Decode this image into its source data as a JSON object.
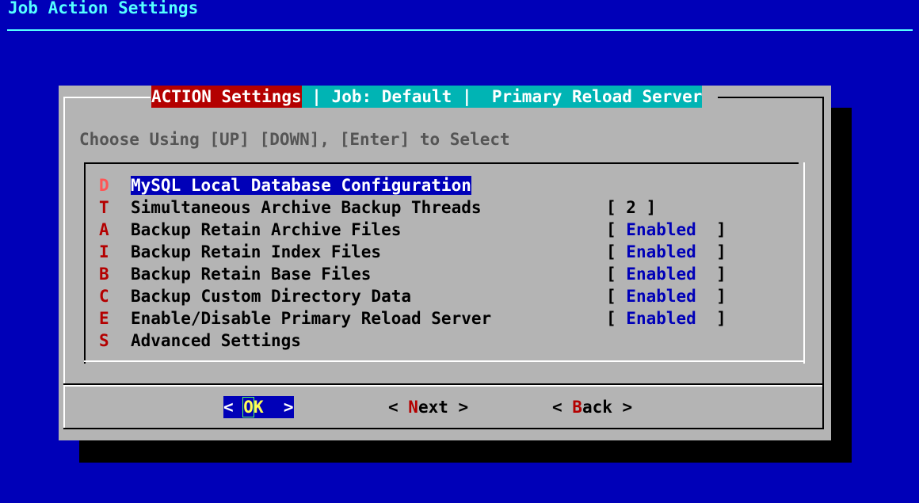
{
  "backtitle": "Job Action Settings",
  "dialog": {
    "title_action": "ACTION Settings",
    "title_rest": " | Job: Default |  Primary Reload Server",
    "prompt": "Choose Using [UP] [DOWN], [Enter] to Select"
  },
  "menu": {
    "items": [
      {
        "tag": "D",
        "label": "MySQL Local Database Configuration",
        "value": ""
      },
      {
        "tag": "T",
        "label": "Simultaneous Archive Backup Threads",
        "value": "2"
      },
      {
        "tag": "A",
        "label": "Backup Retain Archive Files",
        "value": "Enabled"
      },
      {
        "tag": "I",
        "label": "Backup Retain Index Files",
        "value": "Enabled"
      },
      {
        "tag": "B",
        "label": "Backup Retain Base Files",
        "value": "Enabled"
      },
      {
        "tag": "C",
        "label": "Backup Custom Directory Data",
        "value": "Enabled"
      },
      {
        "tag": "E",
        "label": "Enable/Disable Primary Reload Server",
        "value": "Enabled"
      },
      {
        "tag": "S",
        "label": "Advanced Settings",
        "value": ""
      }
    ]
  },
  "buttons": {
    "ok": {
      "left": "< ",
      "hot": "O",
      "rest": "K",
      "right": "  >"
    },
    "next": {
      "left": "< ",
      "hot": "N",
      "rest": "ext",
      "right": " >"
    },
    "back": {
      "left": "< ",
      "hot": "B",
      "rest": "ack",
      "right": " >"
    }
  },
  "colors": {
    "background": "#0000b8",
    "dialog": "#b4b4b4",
    "title_action": "#b40000",
    "title_rest": "#00b4b4",
    "backtitle": "#55ffff",
    "value_highlight": "#0000b8"
  }
}
